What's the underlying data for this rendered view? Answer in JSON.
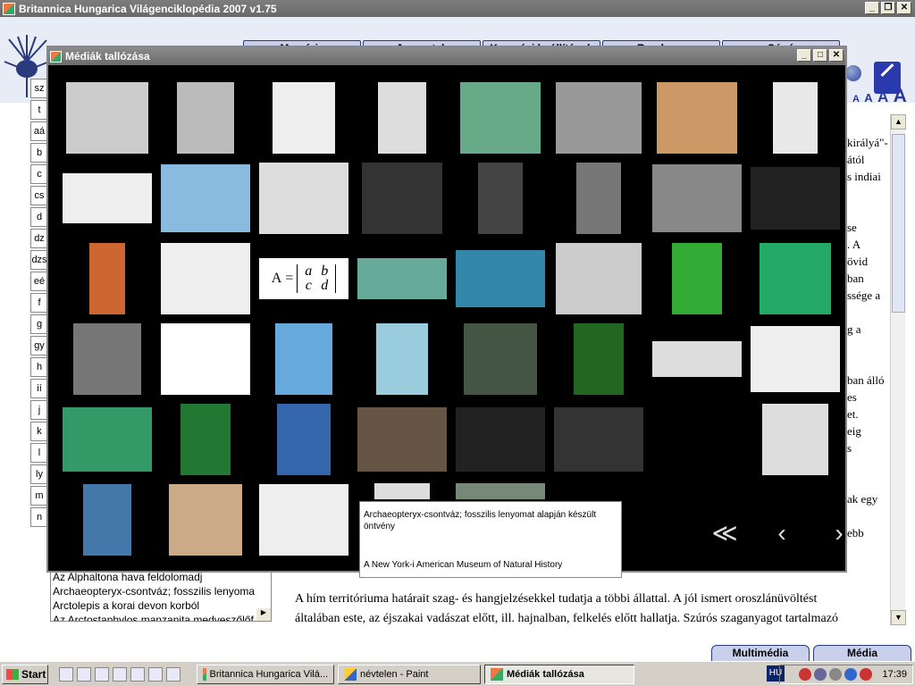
{
  "window": {
    "title": "Britannica Hungarica Világenciklopédia 2007 v1.75",
    "min": "_",
    "max": "❐",
    "close": "✕"
  },
  "menu": [
    "Memória",
    "Jegyzetek",
    "Keresési beállítások",
    "Rendszer",
    "Súgó"
  ],
  "font_sizes": [
    "A",
    "A",
    "A",
    "A"
  ],
  "alphabet": [
    "sz",
    "t",
    "aá",
    "b",
    "c",
    "cs",
    "d",
    "dz",
    "dzs",
    "eé",
    "f",
    "g",
    "gy",
    "h",
    "ií",
    "j",
    "k",
    "l",
    "ly",
    "m",
    "n"
  ],
  "dialog": {
    "title": "Médiák tallózása",
    "min": "_",
    "max": "□",
    "close": "✕",
    "tooltip_caption": "Archaeopteryx-csontváz; fosszilis lenyomat alapján készült öntvény",
    "tooltip_source": "A New York-i American Museum of Natural History",
    "nav_first": "≪",
    "nav_prev": "‹",
    "nav_next": "›",
    "matrix_text": "A",
    "matrix_cells": [
      "a",
      "b",
      "c",
      "d"
    ]
  },
  "results": [
    "Az Alphaltona hava feldolomadj",
    "Archaeopteryx-csontváz; fosszilis lenyoma",
    "Arctolepis a korai devon korból",
    "Az Arctostaphylos manzanita medveszőlőf"
  ],
  "article_lines": [
    "A hím territóriuma határait szag- és hangjelzésekkel tudatja a többi állattal. A jól ismert oroszlánüvöltést",
    "általában este, az éjszakai vadászat előtt, ill. hajnalban, felkelés előtt hallatja. Szúrós szaganyagot tartalmazó"
  ],
  "right_fragments": [
    "királyá\"-",
    "ától",
    "s indiai",
    "",
    "",
    "se",
    ". A",
    "övid",
    "ban",
    "ssége a",
    "",
    "g a",
    "",
    "",
    "ban álló",
    "es",
    "et.",
    "eig",
    "s",
    "",
    "",
    "ak egy",
    "",
    "ebb"
  ],
  "bottom_tabs": [
    "Multimédia",
    "Média"
  ],
  "taskbar": {
    "start": "Start",
    "tasks": [
      "Britannica Hungarica Vilá...",
      "névtelen - Paint",
      "Médiák tallózása"
    ],
    "lang": "HU",
    "clock": "17:39"
  }
}
